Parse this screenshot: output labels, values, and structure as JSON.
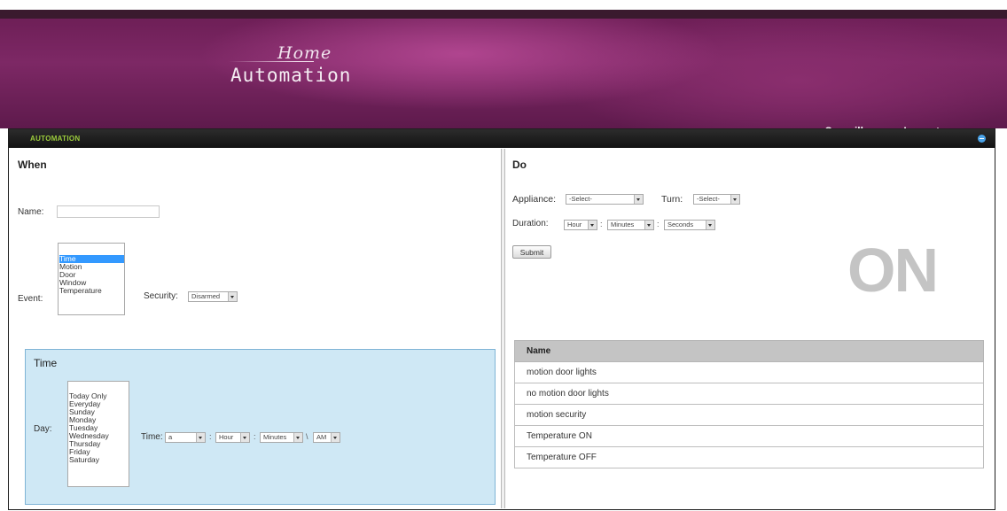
{
  "header": {
    "logo_home": "Home",
    "logo_automation": "Automation",
    "nav": {
      "surveillance": "Surveillance",
      "logout": "Logout"
    }
  },
  "panel": {
    "title": "AUTOMATION"
  },
  "when": {
    "title": "When",
    "name_label": "Name:",
    "name_value": "",
    "event_label": "Event:",
    "event_options": [
      "Time",
      "Motion",
      "Door",
      "Window",
      "Temperature"
    ],
    "event_selected": "Time",
    "security_label": "Security:",
    "security_value": "Disarmed",
    "time_section": {
      "title": "Time",
      "day_label": "Day:",
      "day_options": [
        "Today Only",
        "Everyday",
        "Sunday",
        "Monday",
        "Tuesday",
        "Wednesday",
        "Thursday",
        "Friday",
        "Saturday"
      ],
      "time_label": "Time:",
      "time_field_1": "a",
      "time_hour": "Hour",
      "time_minutes": "Minutes",
      "time_sep_1": ":",
      "time_sep_2": "\\",
      "time_ampm": "AM"
    }
  },
  "do": {
    "title": "Do",
    "appliance_label": "Appliance:",
    "appliance_value": "-Select-",
    "turn_label": "Turn:",
    "turn_value": "-Select-",
    "duration_label": "Duration:",
    "duration_hour": "Hour",
    "duration_minutes": "Minutes",
    "duration_seconds": "Seconds",
    "duration_sep": ":",
    "submit_label": "Submit",
    "status_text": "ON",
    "table": {
      "header": "Name",
      "rows": [
        "motion door lights",
        "no motion door lights",
        "motion security",
        "Temperature ON",
        "Temperature OFF"
      ]
    }
  }
}
